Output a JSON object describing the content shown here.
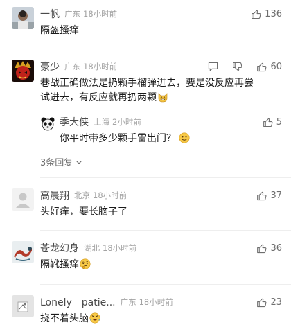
{
  "comments": [
    {
      "username": "一帆",
      "location": "广东",
      "time": "18小时前",
      "text": "隔盔搔痒",
      "likes": "136",
      "avatar": "avatar-photo-person-icon"
    },
    {
      "username": "豪少",
      "location": "广东",
      "time": "18小时前",
      "text_line1": "巷战正确做法是扔颗手榴弹进去，要是没反应再尝",
      "text_line2": "试进去，有反应就再扔两颗",
      "emoji": "cat-grin-emoji",
      "likes": "60",
      "avatar": "avatar-red-mask-icon",
      "reply": {
        "username": "季大侠",
        "location": "上海",
        "time": "2小时前",
        "text": "你平时带多少颗手雷出门？",
        "emoji": "smile-emoji",
        "likes": "5",
        "avatar": "avatar-panda-icon"
      },
      "more_replies_label": "3条回复"
    },
    {
      "username": "高晨翔",
      "location": "北京",
      "time": "18小时前",
      "text": "头好痒，要长脑子了",
      "likes": "37",
      "avatar": "avatar-default-icon"
    },
    {
      "username": "苍龙幻身",
      "location": "湖北",
      "time": "18小时前",
      "text": "隔靴搔痒",
      "emoji": "thinking-emoji",
      "likes": "36",
      "avatar": "avatar-dragon-icon"
    },
    {
      "username": "Lonely　patie...",
      "location": "广东",
      "time": "18小时前",
      "text": "挠不着头脑",
      "emoji": "laughing-tears-emoji",
      "likes": "23",
      "avatar": "avatar-sketch-icon"
    }
  ],
  "colors": {
    "username": "#4a4a4a",
    "meta": "#a3a3a3",
    "text": "#1a1a1a",
    "icon": "#6e6e6e",
    "divider": "#eeeeee"
  }
}
